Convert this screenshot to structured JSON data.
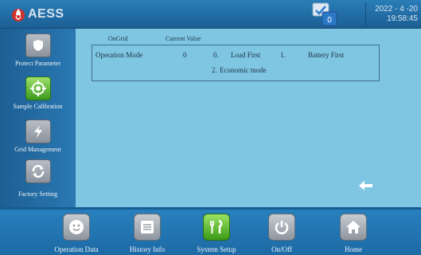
{
  "header": {
    "brand": "AESS",
    "badge_count": "0",
    "date": "2022 - 4 -20",
    "time": "19:58:45"
  },
  "sidebar": {
    "items": [
      {
        "label": "Protect Parameter",
        "icon": "shield-icon"
      },
      {
        "label": "Sample Calibration",
        "icon": "target-icon",
        "active": true
      },
      {
        "label": "Grid Management",
        "icon": "lightning-icon"
      },
      {
        "label": "Factory Setting",
        "icon": "refresh-icon"
      }
    ]
  },
  "main": {
    "column_headers": [
      "OnGrid",
      "Current Value"
    ],
    "param": {
      "name": "Operation Mode",
      "current_value": "0",
      "options": [
        {
          "code": "0.",
          "label": "Load First"
        },
        {
          "code": "1.",
          "label": "Battery First"
        },
        {
          "code": "2.",
          "label": "Economic mode"
        }
      ]
    }
  },
  "bottom_nav": [
    {
      "label": "Operation Data",
      "icon": "smiley-icon"
    },
    {
      "label": "History Info",
      "icon": "list-icon"
    },
    {
      "label": "System Setup",
      "icon": "tools-icon",
      "active": true
    },
    {
      "label": "On/Off",
      "icon": "power-icon"
    },
    {
      "label": "Home",
      "icon": "home-icon"
    }
  ],
  "colors": {
    "accent_active": "#3b9a1c",
    "panel_bg": "#7fc6e2",
    "bar_bg": "#1f6fa8"
  }
}
